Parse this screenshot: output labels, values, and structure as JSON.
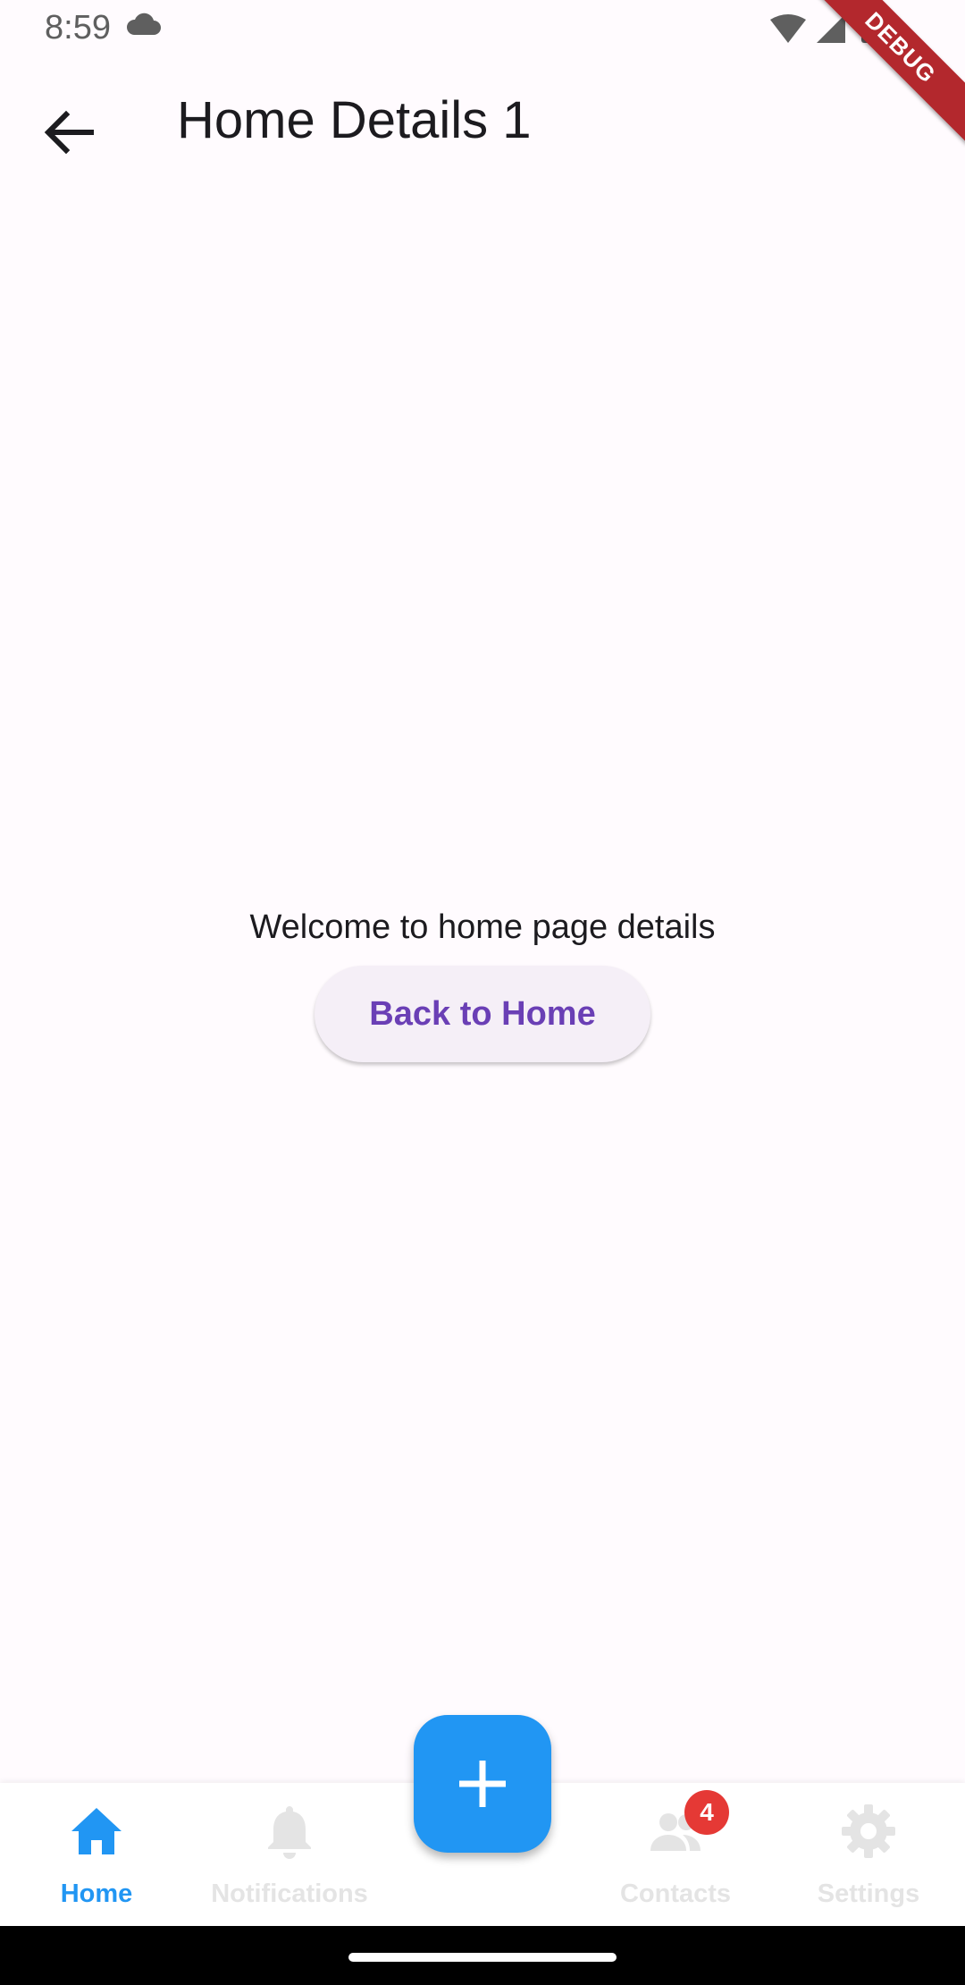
{
  "status_bar": {
    "time": "8:59",
    "icons": [
      "cloud-icon",
      "wifi-icon",
      "signal-icon",
      "battery-icon"
    ]
  },
  "debug_banner": {
    "label": "DEBUG"
  },
  "app_bar": {
    "title": "Home Details 1",
    "back_icon": "arrow-back-icon"
  },
  "body": {
    "welcome_text": "Welcome to home page details",
    "back_button_label": "Back to Home"
  },
  "fab": {
    "icon": "plus-icon",
    "color": "#2196f3"
  },
  "bottom_nav": {
    "items": [
      {
        "label": "Home",
        "icon": "home-icon",
        "active": true
      },
      {
        "label": "Notifications",
        "icon": "bell-icon",
        "active": false
      },
      {
        "label": "Contacts",
        "icon": "people-icon",
        "active": false,
        "badge": "4"
      },
      {
        "label": "Settings",
        "icon": "gear-icon",
        "active": false
      }
    ],
    "active_color": "#2196f3",
    "inactive_color": "#e4e4e4",
    "badge_color": "#e53935"
  }
}
